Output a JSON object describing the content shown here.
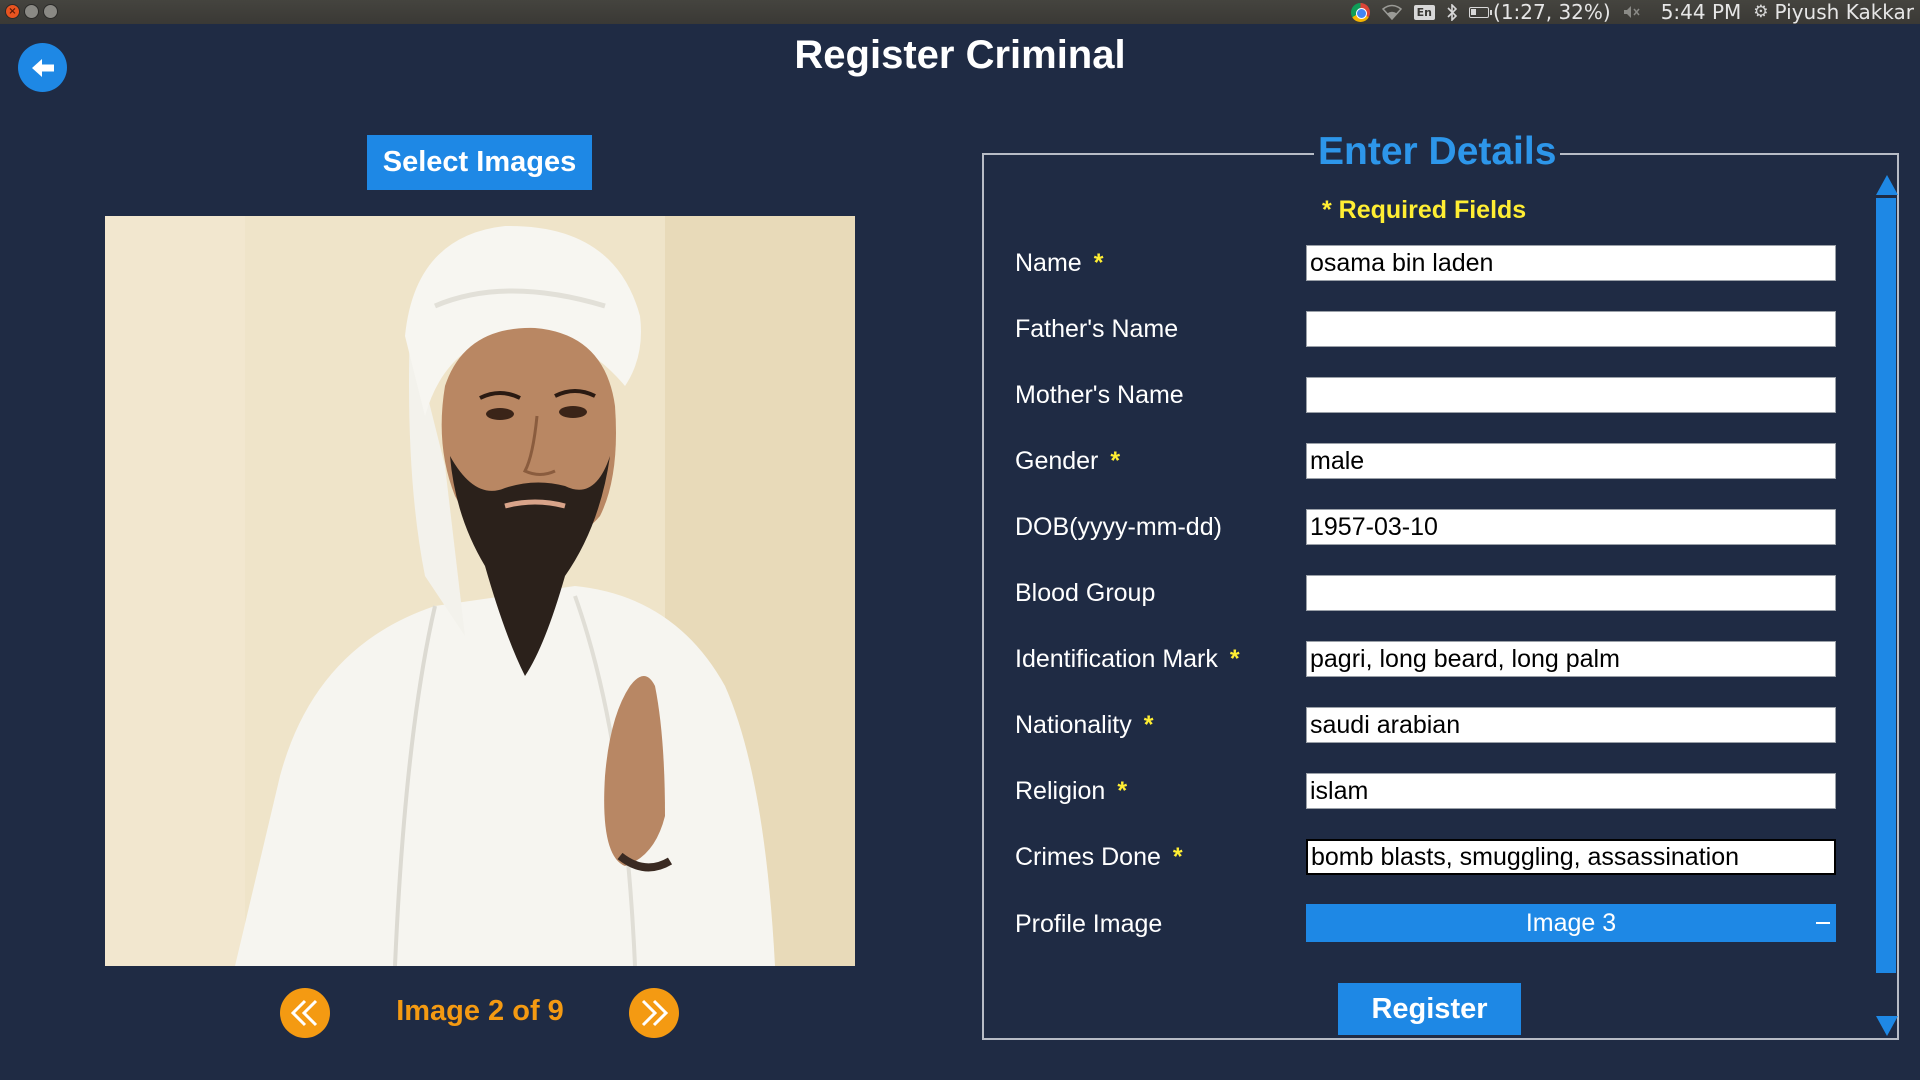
{
  "system_panel": {
    "battery_text": "(1:27, 32%)",
    "time": "5:44 PM",
    "user": "Piyush Kakkar",
    "keyboard_layout": "En",
    "icons": [
      "chrome-icon",
      "wifi-icon",
      "keyboard-layout-icon",
      "bluetooth-icon",
      "battery-icon",
      "volume-icon",
      "settings-gear-icon"
    ]
  },
  "header": {
    "title": "Register Criminal",
    "back_icon": "arrow-left-icon"
  },
  "left_panel": {
    "select_images_label": "Select Images",
    "image_counter": "Image 2 of 9",
    "prev_icon": "double-chevron-left-icon",
    "next_icon": "double-chevron-right-icon"
  },
  "form": {
    "legend": "Enter Details",
    "required_note": "* Required Fields",
    "fields": [
      {
        "label": "Name",
        "required": true,
        "value": ""
      },
      {
        "label": "Father's Name",
        "required": false,
        "value": ""
      },
      {
        "label": "Mother's Name",
        "required": false,
        "value": ""
      },
      {
        "label": "Gender",
        "required": true,
        "value": "male"
      },
      {
        "label": "DOB(yyyy-mm-dd)",
        "required": false,
        "value": "1957-03-10"
      },
      {
        "label": "Blood Group",
        "required": false,
        "value": ""
      },
      {
        "label": "Identification Mark",
        "required": true,
        "value": "pagri, long beard, long palm"
      },
      {
        "label": "Nationality",
        "required": true,
        "value": "saudi arabian"
      },
      {
        "label": "Religion",
        "required": true,
        "value": "islam"
      },
      {
        "label": "Crimes Done",
        "required": true,
        "value": "bomb blasts, smuggling, assassination"
      }
    ],
    "name_value": "osama bin laden",
    "star": "*",
    "profile_image": {
      "label": "Profile Image",
      "selected": "Image 3"
    },
    "register_label": "Register"
  },
  "colors": {
    "background": "#1f2b44",
    "accent_blue": "#1e88e5",
    "legend_blue": "#2d96ea",
    "required_yellow": "#ffee33",
    "nav_orange": "#f49a12"
  }
}
